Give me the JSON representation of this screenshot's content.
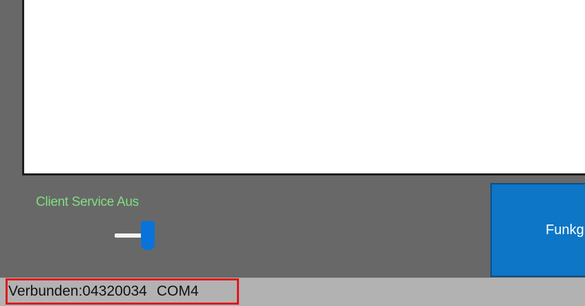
{
  "service": {
    "label": "Client Service Aus",
    "toggle_state": "off"
  },
  "function_button": {
    "label": "Funkg"
  },
  "status": {
    "connected": "Verbunden:04320034",
    "port": "COM4"
  },
  "colors": {
    "background": "#686868",
    "service_label": "#7fe07f",
    "accent": "#0a73d9",
    "highlight_border": "#e2151c",
    "status_bar": "#b2b2b2"
  }
}
